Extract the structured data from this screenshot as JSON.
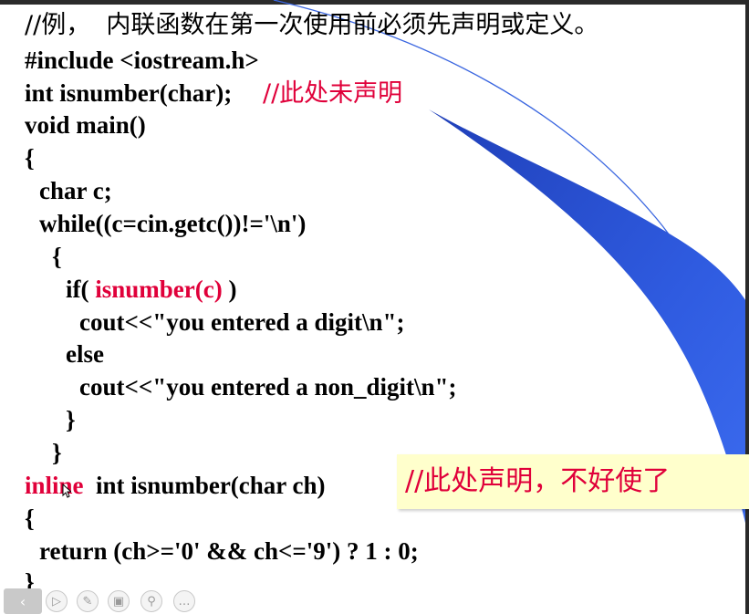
{
  "code": {
    "line1": "//例，  内联函数在第一次使用前必须先声明或定义。",
    "line2": "#include <iostream.h>",
    "line3_code": "int isnumber(char);     ",
    "line3_comment": "//此处未声明",
    "line4": "void main()",
    "line5": "{",
    "line6": "char c;",
    "line7": "while((c=cin.getc())!='\\n')",
    "line8": "{",
    "line9_pre": "if( ",
    "line9_call": "isnumber(c)",
    "line9_post": " )",
    "line10": "cout<<\"you entered a digit\\n\";",
    "line11": "else",
    "line12": "cout<<\"you entered a non_digit\\n\";",
    "line13": "}",
    "line14": "}",
    "line15_keyword": "inline",
    "line15_code": "  int isnumber(char ch)",
    "line16": "{",
    "line17": "return (ch>='0' && ch<='9') ? 1 : 0;",
    "line18": "}"
  },
  "callout": {
    "text": "//此处声明，不好使了"
  },
  "toolbar": {
    "items": [
      {
        "icon": "back-arrow-icon"
      },
      {
        "icon": "play-icon"
      },
      {
        "icon": "pen-icon"
      },
      {
        "icon": "slides-icon"
      },
      {
        "icon": "zoom-icon"
      },
      {
        "icon": "more-icon"
      }
    ]
  },
  "colors": {
    "keyword_red": "#e0003a",
    "callout_bg": "#ffffcc",
    "decor_blue": "#2f5be0"
  }
}
